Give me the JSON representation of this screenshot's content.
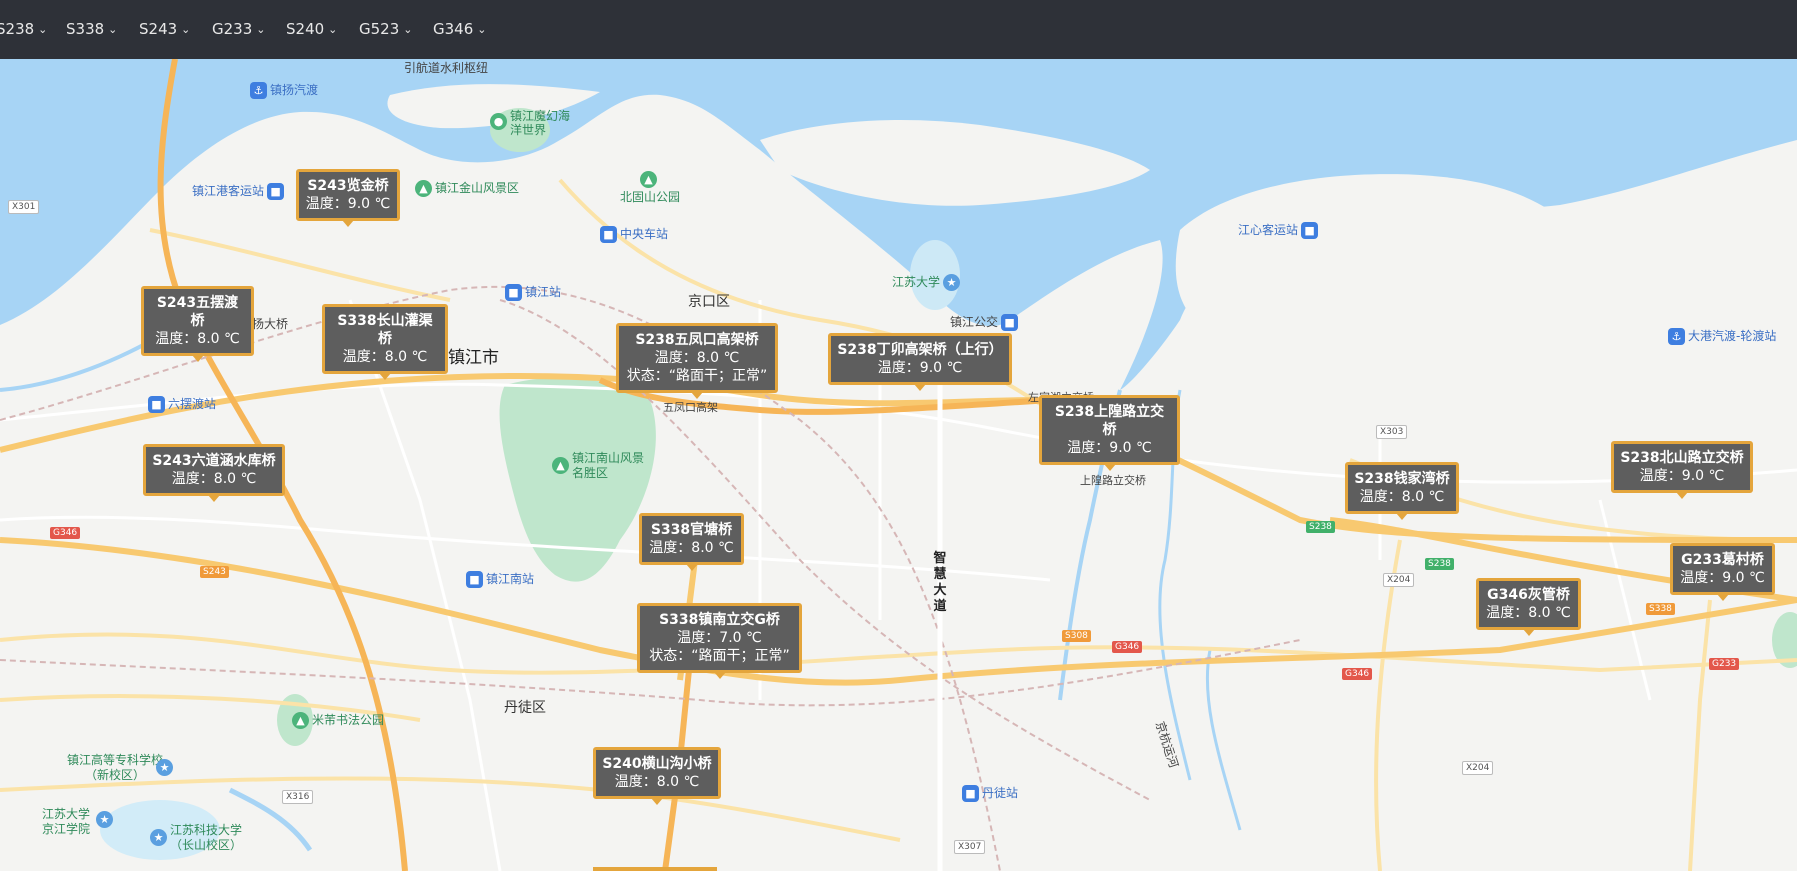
{
  "menu": [
    {
      "label": "S238"
    },
    {
      "label": "S338"
    },
    {
      "label": "S243"
    },
    {
      "label": "G233"
    },
    {
      "label": "S240"
    },
    {
      "label": "G523"
    },
    {
      "label": "G346"
    }
  ],
  "map": {
    "districts": {
      "jingkou": "京口区",
      "zhenjiang_city": "镇江市",
      "dantu": "丹徒区"
    },
    "roads": {
      "zhihui_dadao": "智慧大道",
      "jinghang_canal": "京杭运河"
    },
    "pois": {
      "yinhang": "引航道水利枢纽",
      "zhenyang_ferry": "镇扬汽渡",
      "haiyang": "镇江魔幻海洋世界",
      "gangke": "镇江港客运站",
      "jinshan": "镇江金山风景区",
      "beigushan": "北固山公园",
      "zhongyang": "中央车站",
      "jiangxin": "江心客运站",
      "jiangsu_univ": "江苏大学",
      "zhenjiang_zhan": "镇江站",
      "gongjiao": "镇江公交",
      "jingkou_bridge": "扬大桥",
      "liubai_ferry": "六摆渡站",
      "wufengkou": "五凤口高架",
      "nanshan": "镇江南山风景名胜区",
      "zuohu": "左家湖立交桥",
      "shangdang": "上隍路立交桥",
      "dagang": "大港汽渡-轮渡站",
      "zhenjiang_south": "镇江南站",
      "mifu": "米芾书法公园",
      "gaozhuan": "镇江高等专科学校（新校区）",
      "jingjiang": "江苏大学京江学院",
      "kejidaxue": "江苏科技大学（长山校区）",
      "dantu_station": "丹徒站"
    },
    "shields": {
      "x301": "X301",
      "g346a": "G346",
      "s243": "S243",
      "s238a": "S238",
      "s238b": "S238",
      "x303": "X303",
      "x204a": "X204",
      "s338": "S338",
      "g346b": "G346",
      "g346c": "G346",
      "s308": "S308",
      "g233": "G233",
      "x316": "X316",
      "x204b": "X204",
      "x307": "X307"
    }
  },
  "bridges": [
    {
      "title": "S243览金桥",
      "temp": "温度：9.0 ℃"
    },
    {
      "title": "S243五摆渡桥",
      "temp": "温度：8.0 ℃"
    },
    {
      "title": "S338长山灌渠桥",
      "temp": "温度：8.0 ℃"
    },
    {
      "title": "S238五凤口高架桥",
      "temp": "温度：8.0 ℃",
      "status": "状态：“路面干；正常”"
    },
    {
      "title": "S238丁卯高架桥（上行）",
      "temp": "温度：9.0 ℃"
    },
    {
      "title": "S238上隍路立交桥",
      "temp": "温度：9.0 ℃"
    },
    {
      "title": "S243六道涵水库桥",
      "temp": "温度：8.0 ℃"
    },
    {
      "title": "S338官塘桥",
      "temp": "温度：8.0 ℃"
    },
    {
      "title": "S338镇南立交G桥",
      "temp": "温度：7.0 ℃",
      "status": "状态：“路面干；正常”"
    },
    {
      "title": "S238钱家湾桥",
      "temp": "温度：8.0 ℃"
    },
    {
      "title": "S238北山路立交桥",
      "temp": "温度：9.0 ℃"
    },
    {
      "title": "G233葛村桥",
      "temp": "温度：9.0 ℃"
    },
    {
      "title": "G346灰管桥",
      "temp": "温度：8.0 ℃"
    },
    {
      "title": "S240横山沟小桥",
      "temp": "温度：8.0 ℃"
    }
  ],
  "colors": {
    "water": "#a7d4f5",
    "land": "#f4f4f2",
    "park": "#bfe6cc",
    "expressway": "#f6b557",
    "road": "#fbe3a8",
    "topbar": "#2e3138",
    "card_bg": "#5e5e5e",
    "card_border": "#e4a53c"
  }
}
